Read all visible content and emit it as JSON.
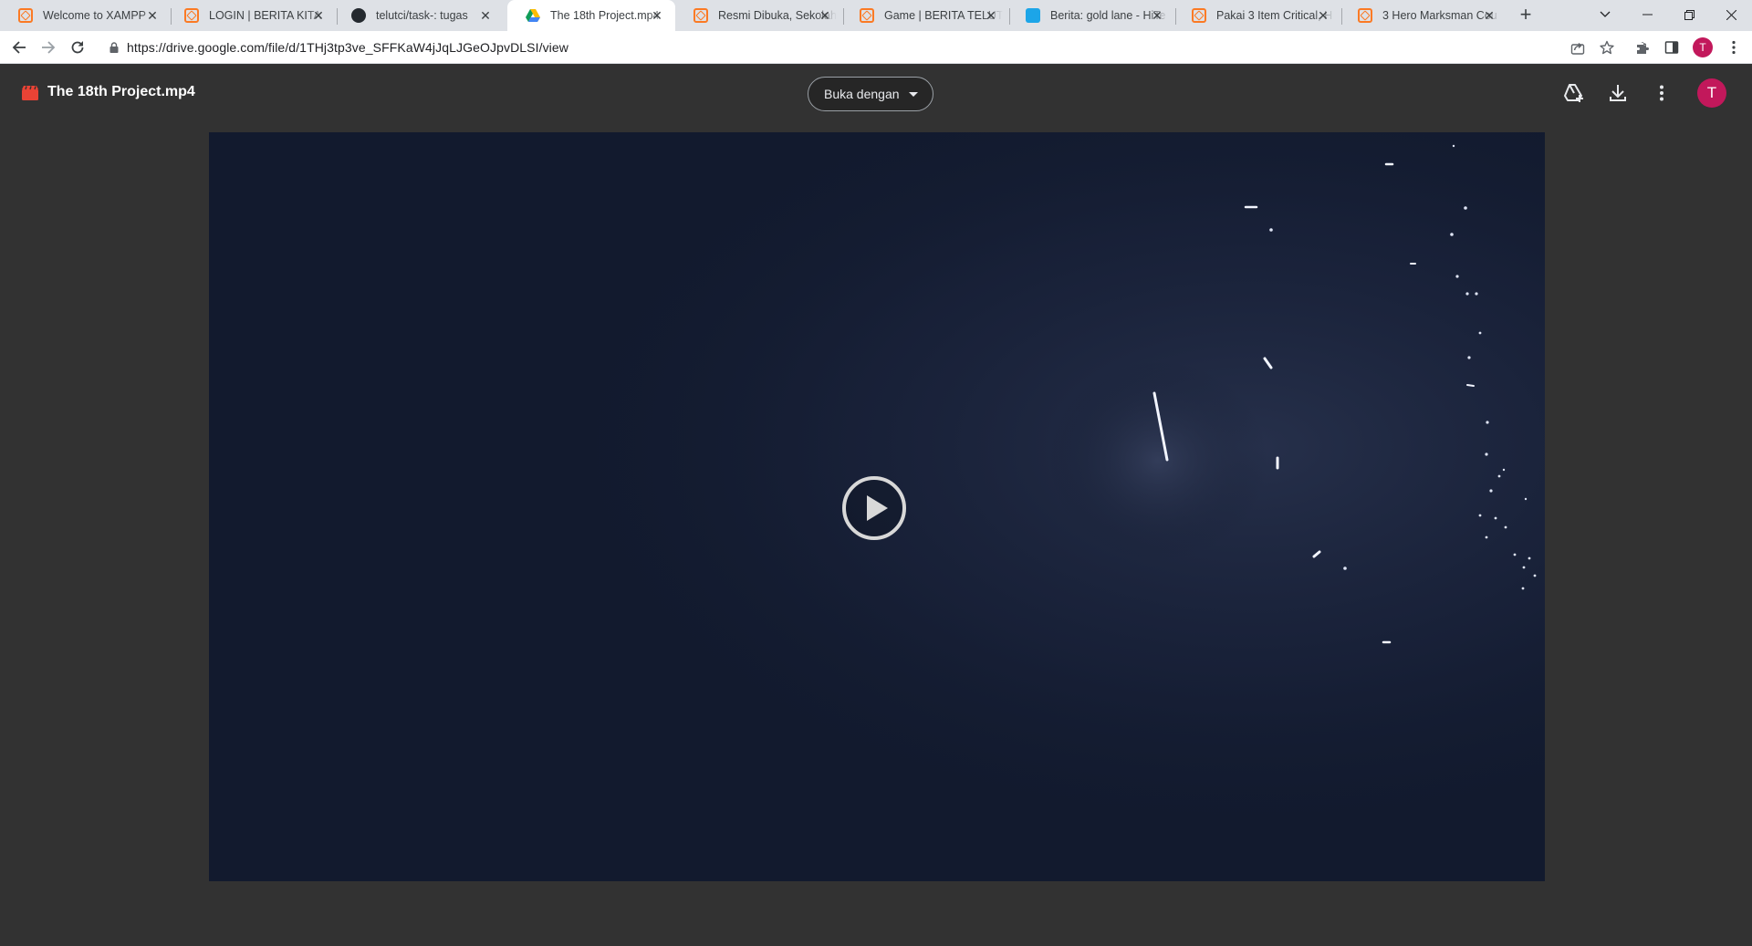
{
  "browser": {
    "tabs": [
      {
        "title": "Welcome to XAMPP",
        "favicon": "xampp-icon",
        "active": false
      },
      {
        "title": "LOGIN | BERITA KITA",
        "favicon": "xampp-icon",
        "active": false
      },
      {
        "title": "telutci/task-: tugas",
        "favicon": "github-icon",
        "active": false
      },
      {
        "title": "The 18th Project.mp4",
        "favicon": "google-drive-icon",
        "active": true
      },
      {
        "title": "Resmi Dibuka, Sekolah",
        "favicon": "xampp-icon",
        "active": false
      },
      {
        "title": "Game | BERITA TELUTC",
        "favicon": "xampp-icon",
        "active": false
      },
      {
        "title": "Berita: gold lane - HiTe",
        "favicon": "hitekno-icon",
        "active": false
      },
      {
        "title": "Pakai 3 Item Critical, H",
        "favicon": "xampp-icon",
        "active": false
      },
      {
        "title": "3 Hero Marksman Cou",
        "favicon": "xampp-icon",
        "active": false
      }
    ],
    "url": "https://drive.google.com/file/d/1THj3tp3ve_SFFKaW4jJqLJGeOJpvDLSI/view",
    "profile_initial": "T"
  },
  "viewer": {
    "file_title": "The 18th Project.mp4",
    "open_with_label": "Buka dengan",
    "avatar_initial": "T",
    "accent_color": "#c2185b",
    "video_state": "paused"
  }
}
